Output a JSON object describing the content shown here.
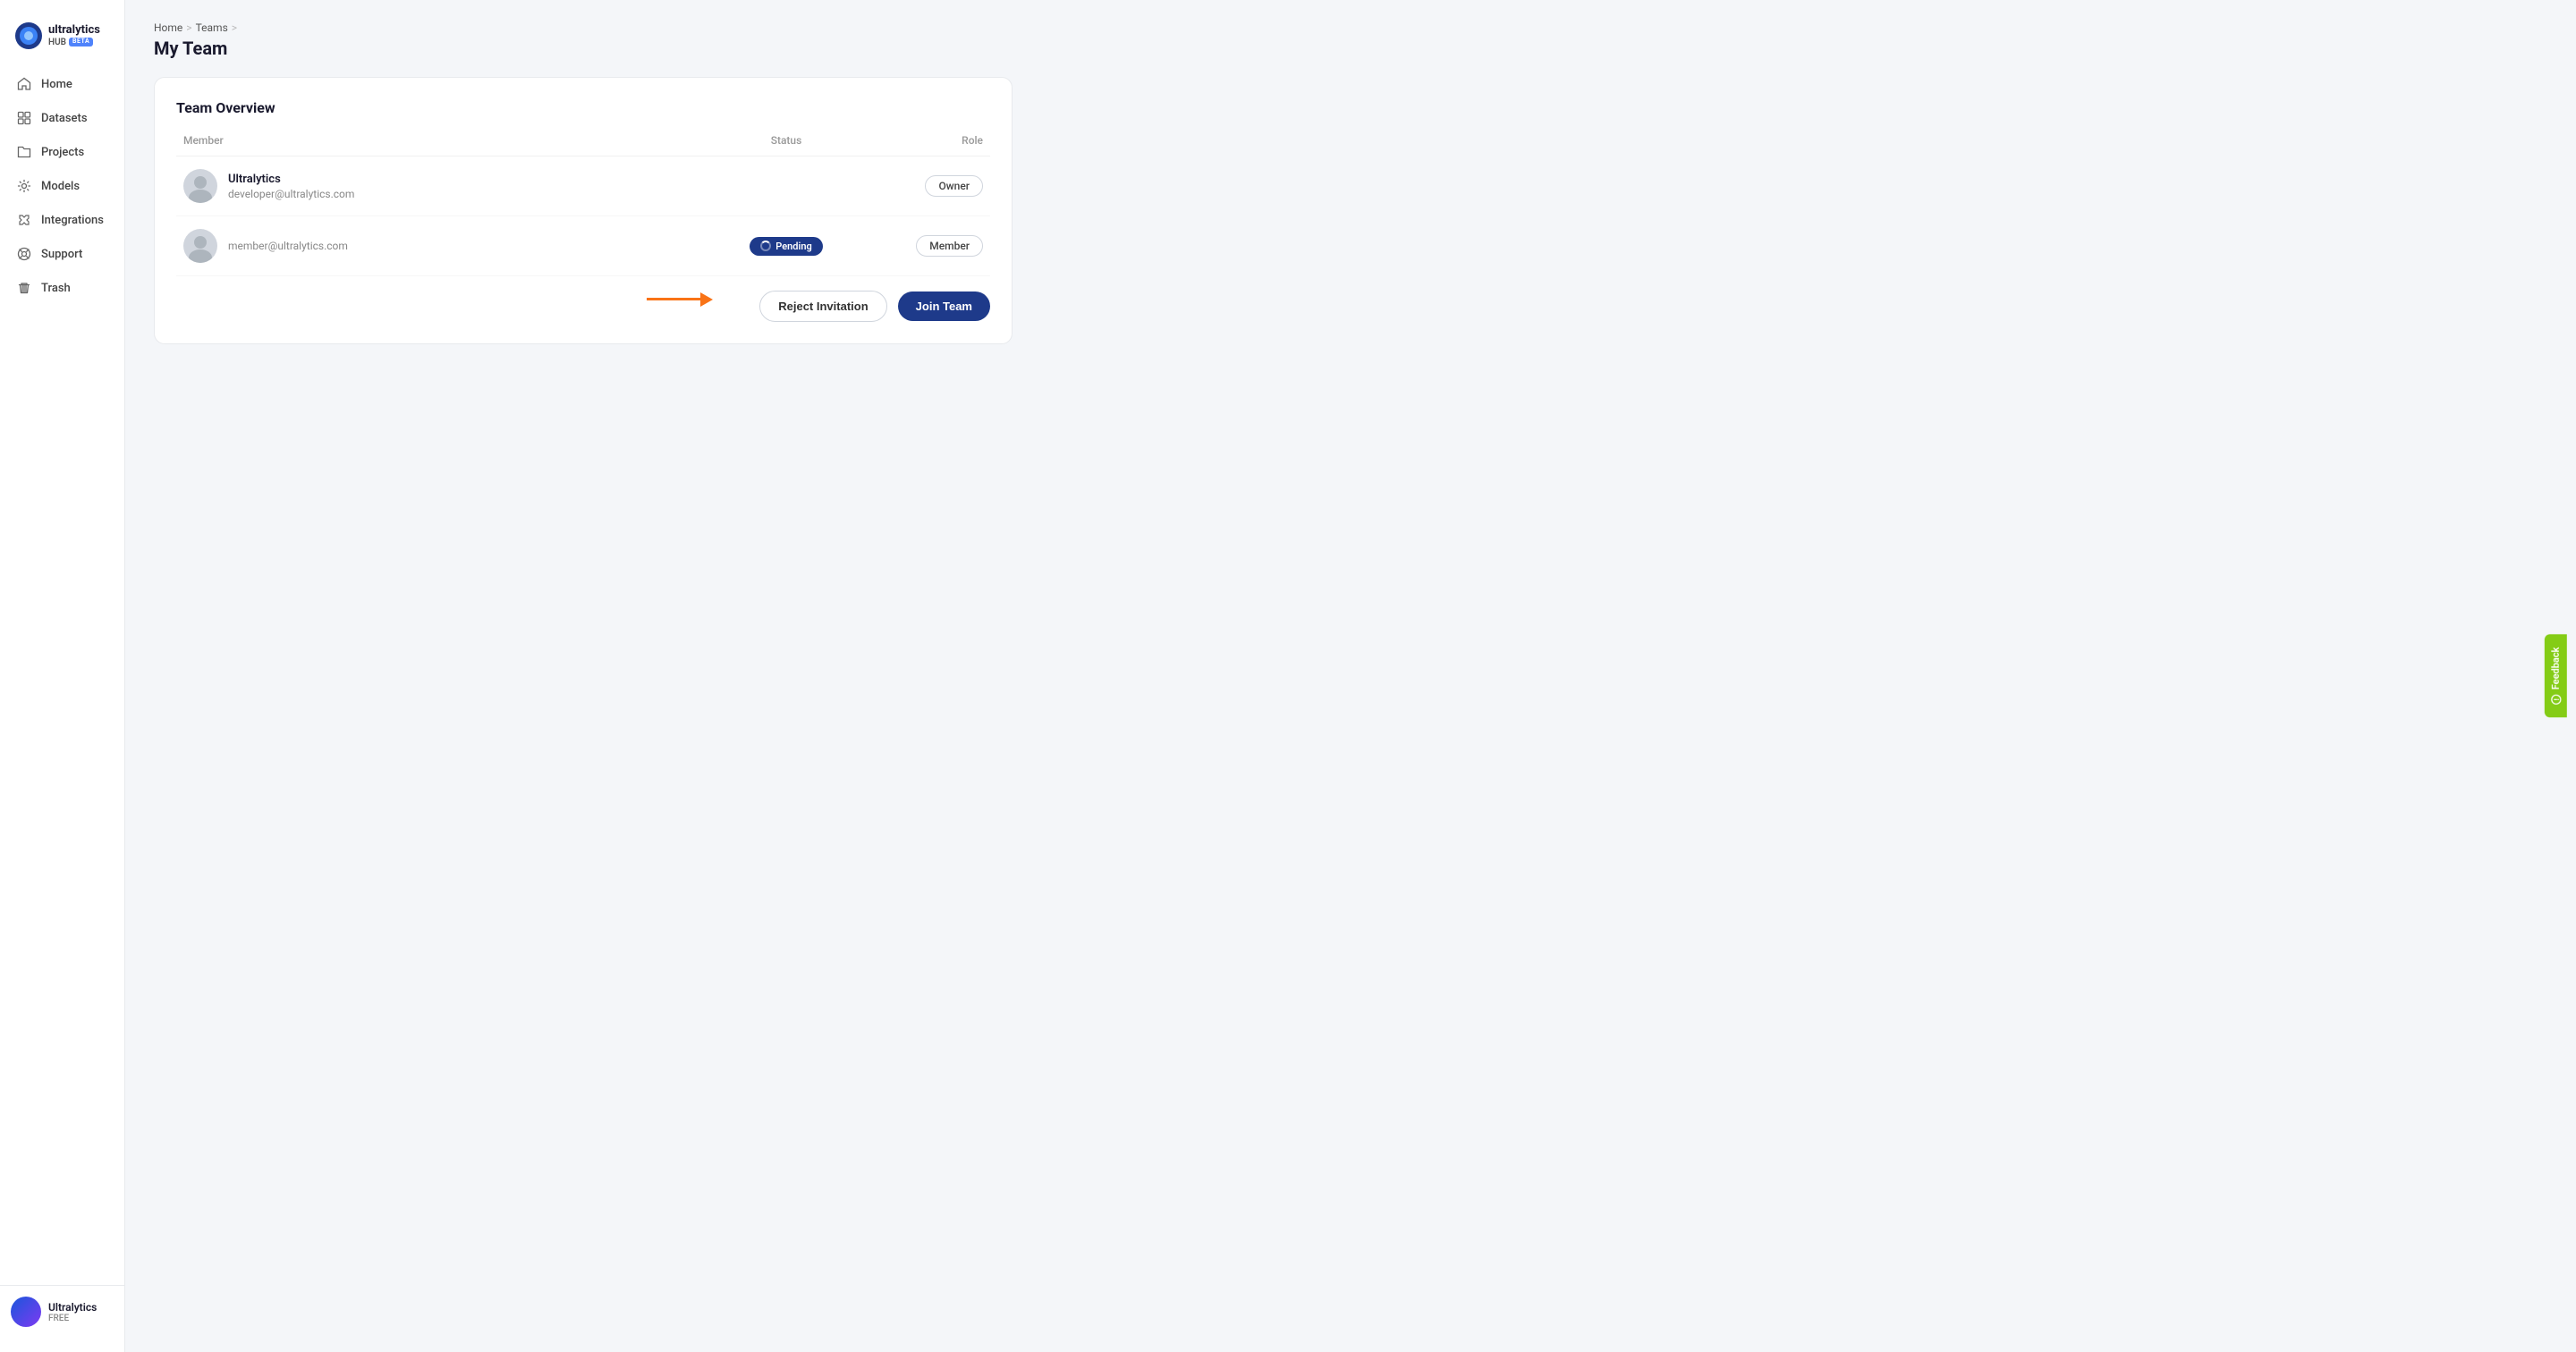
{
  "sidebar": {
    "logo": {
      "name": "ultralytics",
      "hub": "HUB",
      "beta": "BETA"
    },
    "nav_items": [
      {
        "id": "home",
        "label": "Home",
        "icon": "home"
      },
      {
        "id": "datasets",
        "label": "Datasets",
        "icon": "datasets"
      },
      {
        "id": "projects",
        "label": "Projects",
        "icon": "projects"
      },
      {
        "id": "models",
        "label": "Models",
        "icon": "models"
      },
      {
        "id": "integrations",
        "label": "Integrations",
        "icon": "integrations"
      },
      {
        "id": "support",
        "label": "Support",
        "icon": "support"
      },
      {
        "id": "trash",
        "label": "Trash",
        "icon": "trash"
      }
    ],
    "footer": {
      "name": "Ultralytics",
      "plan": "FREE"
    }
  },
  "breadcrumb": {
    "items": [
      "Home",
      "Teams"
    ],
    "current": "My Team"
  },
  "page_title": "My Team",
  "team_overview": {
    "title": "Team Overview",
    "columns": {
      "member": "Member",
      "status": "Status",
      "role": "Role"
    },
    "members": [
      {
        "name": "Ultralytics",
        "email": "developer@ultralytics.com",
        "status": "",
        "role": "Owner"
      },
      {
        "name": "",
        "email": "member@ultralytics.com",
        "status": "Pending",
        "role": "Member"
      }
    ]
  },
  "actions": {
    "reject_label": "Reject Invitation",
    "join_label": "Join Team"
  },
  "feedback": {
    "label": "Feedback"
  }
}
